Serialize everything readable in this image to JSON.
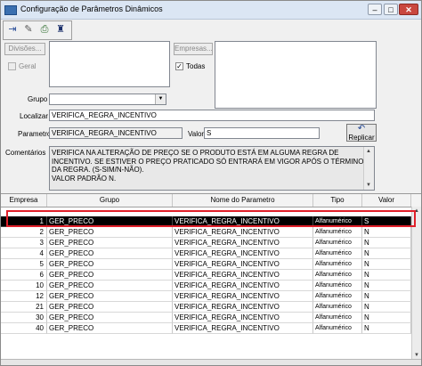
{
  "window": {
    "title": "Configuração de Parâmetros Dinâmicos",
    "minimize_glyph": "–",
    "maximize_glyph": "□",
    "close_glyph": "✕"
  },
  "toolbar": {
    "icons": [
      "exit-door-icon",
      "eraser-icon",
      "print-icon",
      "binoculars-icon"
    ],
    "glyphs": [
      "⇥",
      "✎",
      "⎙",
      "♜"
    ]
  },
  "divisoes": {
    "button_label": "Divisões...",
    "checkbox_label": "Geral",
    "checked": false
  },
  "empresas": {
    "button_label": "Empresas...",
    "checkbox_label": "Todas",
    "checked": true,
    "check_glyph": "✓"
  },
  "grupo": {
    "label": "Grupo",
    "value": "",
    "arrow": "▼"
  },
  "localizar": {
    "label": "Localizar",
    "value": "VERIFICA_REGRA_INCENTIVO"
  },
  "parametro": {
    "label": "Parametro",
    "value": "VERIFICA_REGRA_INCENTIVO"
  },
  "valor": {
    "label": "Valor",
    "value": "S"
  },
  "replicar": {
    "label": "Replicar",
    "icon_glyph": "↶"
  },
  "comentarios": {
    "label": "Comentários",
    "text": "VERIFICA NA ALTERAÇÃO DE PREÇO SE O PRODUTO ESTÁ EM ALGUMA REGRA DE INCENTIVO. SE ESTIVER O PREÇO PRATICADO SÓ ENTRARÁ EM VIGOR APÓS O TÉRMINO DA REGRA. (S-SIM/N-NÃO).\nVALOR PADRÃO N."
  },
  "scroll": {
    "up": "▲",
    "down": "▼"
  },
  "table": {
    "columns": [
      "Empresa",
      "Grupo",
      "Nome do Parametro",
      "Tipo",
      "Valor"
    ],
    "rows": [
      {
        "empresa": "1",
        "grupo": "GER_PRECO",
        "nome": "VERIFICA_REGRA_INCENTIVO",
        "tipo": "Alfanumérico",
        "valor": "S"
      },
      {
        "empresa": "2",
        "grupo": "GER_PRECO",
        "nome": "VERIFICA_REGRA_INCENTIVO",
        "tipo": "Alfanumérico",
        "valor": "N"
      },
      {
        "empresa": "3",
        "grupo": "GER_PRECO",
        "nome": "VERIFICA_REGRA_INCENTIVO",
        "tipo": "Alfanumérico",
        "valor": "N"
      },
      {
        "empresa": "4",
        "grupo": "GER_PRECO",
        "nome": "VERIFICA_REGRA_INCENTIVO",
        "tipo": "Alfanumérico",
        "valor": "N"
      },
      {
        "empresa": "5",
        "grupo": "GER_PRECO",
        "nome": "VERIFICA_REGRA_INCENTIVO",
        "tipo": "Alfanumérico",
        "valor": "N"
      },
      {
        "empresa": "6",
        "grupo": "GER_PRECO",
        "nome": "VERIFICA_REGRA_INCENTIVO",
        "tipo": "Alfanumérico",
        "valor": "N"
      },
      {
        "empresa": "10",
        "grupo": "GER_PRECO",
        "nome": "VERIFICA_REGRA_INCENTIVO",
        "tipo": "Alfanumérico",
        "valor": "N"
      },
      {
        "empresa": "12",
        "grupo": "GER_PRECO",
        "nome": "VERIFICA_REGRA_INCENTIVO",
        "tipo": "Alfanumérico",
        "valor": "N"
      },
      {
        "empresa": "21",
        "grupo": "GER_PRECO",
        "nome": "VERIFICA_REGRA_INCENTIVO",
        "tipo": "Alfanumérico",
        "valor": "N"
      },
      {
        "empresa": "30",
        "grupo": "GER_PRECO",
        "nome": "VERIFICA_REGRA_INCENTIVO",
        "tipo": "Alfanumérico",
        "valor": "N"
      },
      {
        "empresa": "40",
        "grupo": "GER_PRECO",
        "nome": "VERIFICA_REGRA_INCENTIVO",
        "tipo": "Alfanumérico",
        "valor": "N"
      }
    ]
  },
  "colors": {
    "selection": "#000000",
    "highlight": "#e0202a"
  }
}
